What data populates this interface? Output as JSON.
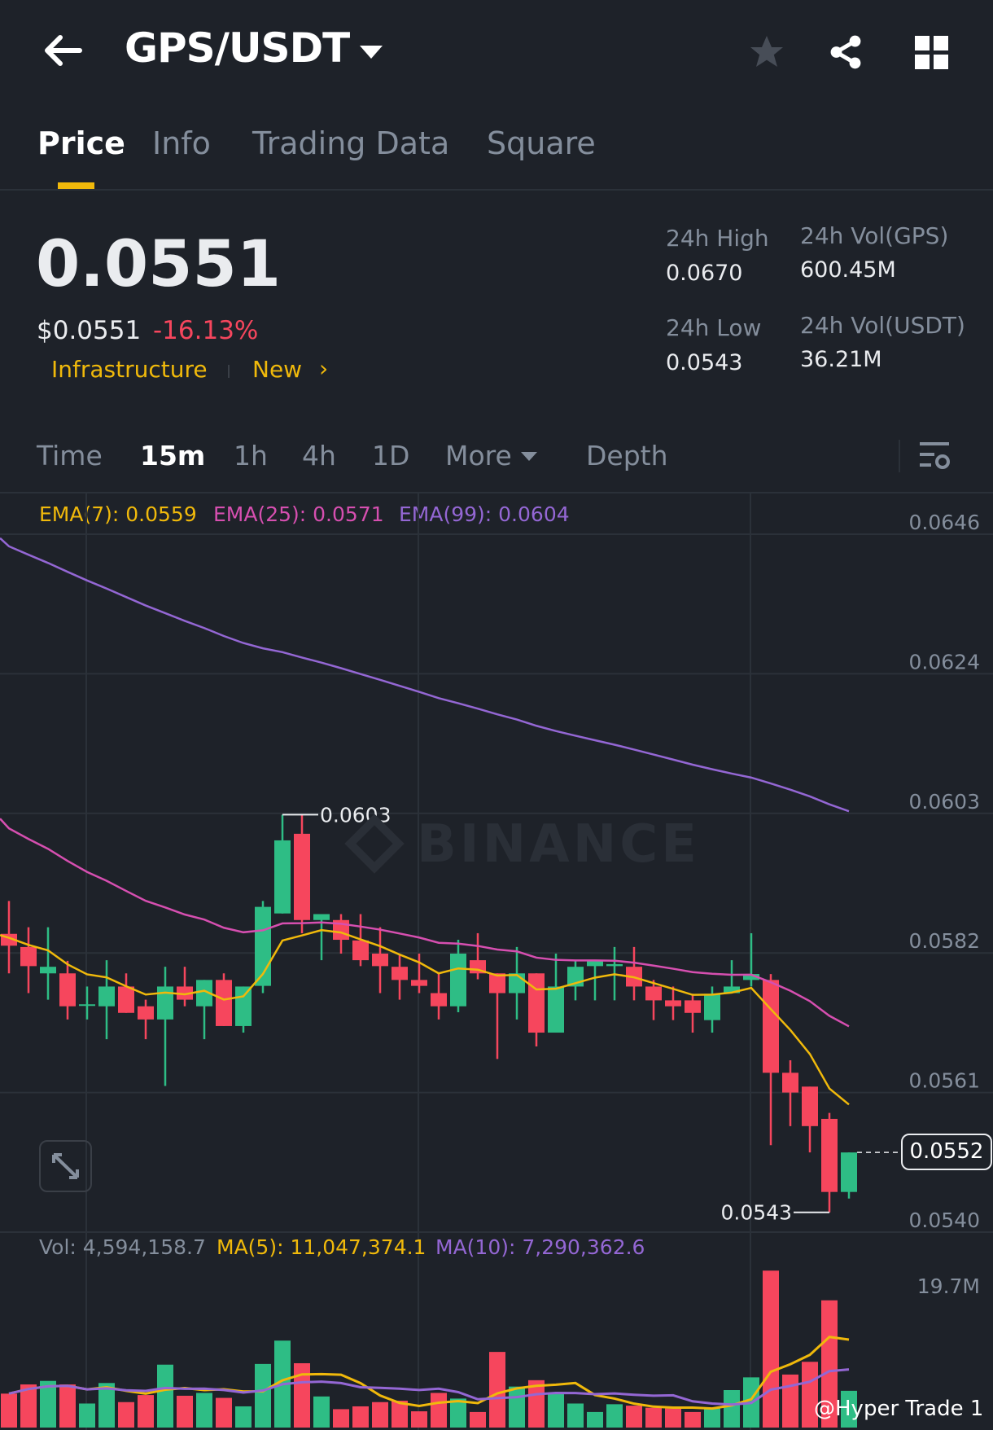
{
  "header": {
    "title": "GPS/USDT"
  },
  "tabs": [
    {
      "label": "Price"
    },
    {
      "label": "Info"
    },
    {
      "label": "Trading Data"
    },
    {
      "label": "Square"
    }
  ],
  "ticker": {
    "last_price": "0.0551",
    "usd_price": "$0.0551",
    "change_pct": "-16.13%",
    "tag": "Infrastructure",
    "tag_new": "New",
    "high_label": "24h High",
    "high": "0.0670",
    "low_label": "24h Low",
    "low": "0.0543",
    "vol_base_label": "24h Vol(GPS)",
    "vol_base": "600.45M",
    "vol_quote_label": "24h Vol(USDT)",
    "vol_quote": "36.21M"
  },
  "toolbar": {
    "items": [
      "Time",
      "15m",
      "1h",
      "4h",
      "1D"
    ],
    "more": "More",
    "depth": "Depth"
  },
  "indicators": {
    "ema7": "EMA(7): 0.0559",
    "ema25": "EMA(25): 0.0571",
    "ema99": "EMA(99): 0.0604",
    "vol": "Vol: 4,594,158.7",
    "ma5": "MA(5): 11,047,374.1",
    "ma10": "MA(10): 7,290,362.6"
  },
  "watermark": "BINANCE",
  "credit": "@Hyper Trade 1",
  "colors": {
    "up": "#2ebd85",
    "down": "#f6465d",
    "ema7": "#f0b90b",
    "ema25": "#d64fb0",
    "ema99": "#9467d4",
    "accent": "#f0b90b"
  },
  "chart_data": {
    "type": "candlestick",
    "interval": "15m",
    "price_axis": {
      "ticks": [
        "0.0646",
        "0.0624",
        "0.0603",
        "0.0582",
        "0.0561",
        "0.0540"
      ],
      "range": [
        0.054,
        0.0646
      ]
    },
    "current_price_label": "0.0552",
    "high_marker": "0.0603",
    "low_marker": "0.0543",
    "volume_axis": {
      "ticks": [
        "19.7M"
      ],
      "unit": "M"
    },
    "ema_seeds": {
      "ema7": 0.05851,
      "ema25": 0.06028,
      "ema99": 0.06454
    },
    "candles": [
      [
        0.05853,
        0.05903,
        0.05793,
        0.05835
      ],
      [
        0.05833,
        0.05863,
        0.05763,
        0.05804
      ],
      [
        0.05793,
        0.05863,
        0.05753,
        0.05803
      ],
      [
        0.05793,
        0.05812,
        0.05723,
        0.05743
      ],
      [
        0.05744,
        0.05773,
        0.05723,
        0.05746
      ],
      [
        0.05743,
        0.05813,
        0.05693,
        0.05773
      ],
      [
        0.05773,
        0.05793,
        0.05733,
        0.05733
      ],
      [
        0.05743,
        0.05753,
        0.05693,
        0.05723
      ],
      [
        0.05723,
        0.05803,
        0.05622,
        0.05773
      ],
      [
        0.05773,
        0.05803,
        0.05743,
        0.05753
      ],
      [
        0.05743,
        0.05783,
        0.05693,
        0.05783
      ],
      [
        0.05783,
        0.05793,
        0.05713,
        0.05713
      ],
      [
        0.05713,
        0.05773,
        0.05703,
        0.05773
      ],
      [
        0.05774,
        0.05903,
        0.05763,
        0.05894
      ],
      [
        0.05884,
        0.06034,
        0.05884,
        0.05995
      ],
      [
        0.06005,
        0.06034,
        0.05854,
        0.05874
      ],
      [
        0.05874,
        0.05883,
        0.05813,
        0.05883
      ],
      [
        0.05874,
        0.05883,
        0.05823,
        0.05844
      ],
      [
        0.05843,
        0.05883,
        0.05804,
        0.05813
      ],
      [
        0.05823,
        0.05863,
        0.05763,
        0.05804
      ],
      [
        0.05803,
        0.05822,
        0.05753,
        0.05783
      ],
      [
        0.05783,
        0.05823,
        0.05763,
        0.05774
      ],
      [
        0.05763,
        0.05793,
        0.05723,
        0.05743
      ],
      [
        0.05743,
        0.05844,
        0.05734,
        0.05823
      ],
      [
        0.05813,
        0.05854,
        0.05784,
        0.05793
      ],
      [
        0.05793,
        0.05793,
        0.05663,
        0.05763
      ],
      [
        0.05763,
        0.05833,
        0.05723,
        0.05793
      ],
      [
        0.05793,
        0.05793,
        0.05682,
        0.05703
      ],
      [
        0.05703,
        0.05823,
        0.05703,
        0.05773
      ],
      [
        0.05773,
        0.05813,
        0.05752,
        0.05803
      ],
      [
        0.05804,
        0.05812,
        0.05752,
        0.05812
      ],
      [
        0.05804,
        0.05833,
        0.05752,
        0.05807
      ],
      [
        0.05803,
        0.05833,
        0.05752,
        0.05773
      ],
      [
        0.05773,
        0.05783,
        0.05722,
        0.05752
      ],
      [
        0.05752,
        0.05773,
        0.05722,
        0.05743
      ],
      [
        0.05752,
        0.05762,
        0.05703,
        0.05733
      ],
      [
        0.05722,
        0.05773,
        0.05703,
        0.05762
      ],
      [
        0.05763,
        0.05813,
        0.05763,
        0.05773
      ],
      [
        0.05783,
        0.05854,
        0.05773,
        0.05792
      ],
      [
        0.05783,
        0.05792,
        0.05532,
        0.05642
      ],
      [
        0.05642,
        0.05661,
        0.05561,
        0.05612
      ],
      [
        0.05621,
        0.05621,
        0.05521,
        0.05561
      ],
      [
        0.05572,
        0.05581,
        0.0543,
        0.05461
      ],
      [
        0.05461,
        0.05521,
        0.05451,
        0.05521
      ]
    ],
    "candle_fields": [
      "open",
      "high",
      "low",
      "close"
    ],
    "volume_millions": [
      4.8,
      6.1,
      6.6,
      6.1,
      3.4,
      6.3,
      3.6,
      4.6,
      8.9,
      4.5,
      4.9,
      4.2,
      3.0,
      9.0,
      12.3,
      9.1,
      4.4,
      2.6,
      3.0,
      3.6,
      3.8,
      2.3,
      4.9,
      4.1,
      2.2,
      10.7,
      5.8,
      6.7,
      4.9,
      3.4,
      2.2,
      3.3,
      3.1,
      2.8,
      2.7,
      2.2,
      2.7,
      5.3,
      7.1,
      22.2,
      7.5,
      9.3,
      18.0,
      5.2
    ]
  }
}
